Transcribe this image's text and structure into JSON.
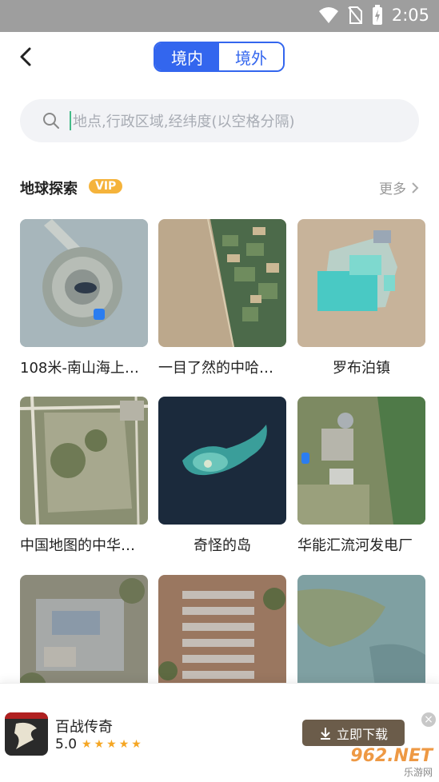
{
  "status": {
    "time": "2:05"
  },
  "header": {
    "tab_active": "境内",
    "tab_inactive": "境外"
  },
  "search": {
    "placeholder": "地点,行政区域,经纬度(以空格分隔)"
  },
  "section": {
    "title": "地球探索",
    "badge": "VIP",
    "more": "更多"
  },
  "cards": [
    {
      "caption": "108米-南山海上…"
    },
    {
      "caption": "一目了然的中哈…"
    },
    {
      "caption": "罗布泊镇"
    },
    {
      "caption": "中国地图的中华…"
    },
    {
      "caption": "奇怪的岛"
    },
    {
      "caption": "华能汇流河发电厂"
    },
    {
      "caption": ""
    },
    {
      "caption": ""
    },
    {
      "caption": ""
    }
  ],
  "ad": {
    "title": "百战传奇",
    "rating": "5.0",
    "button": "立即下载",
    "close": "×",
    "watermark": "962.NET",
    "watermark_sub": "乐游网"
  },
  "colors": {
    "accent": "#3366ee",
    "vip": "#f5b33b",
    "ad_button": "#6b5c4a"
  }
}
